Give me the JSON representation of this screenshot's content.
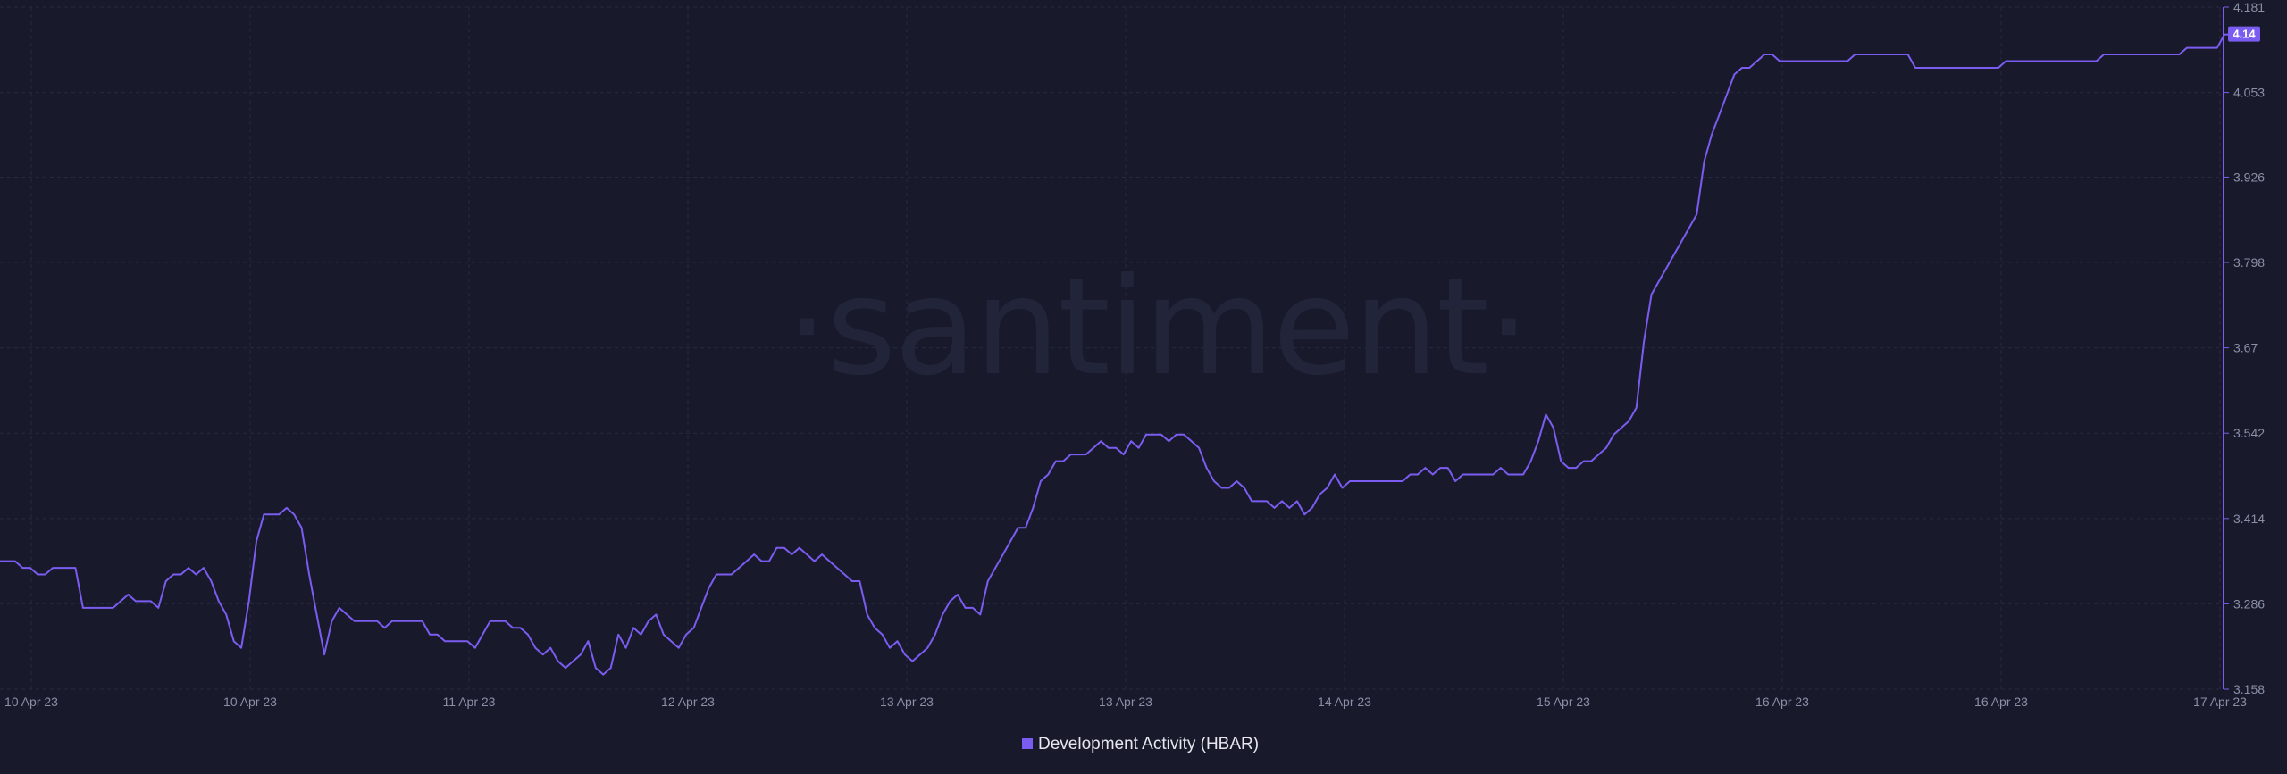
{
  "chart_data": {
    "type": "line",
    "title": "",
    "xlabel": "",
    "ylabel": "",
    "watermark": "·santiment·",
    "accent_color": "#7b5cf0",
    "background_color": "#181a2b",
    "grid": true,
    "legend_position": "bottom-center",
    "ylim": [
      3.158,
      4.181
    ],
    "y_ticks": [
      "4.181",
      "4.053",
      "3.926",
      "3.798",
      "3.67",
      "3.542",
      "3.414",
      "3.286",
      "3.158"
    ],
    "x_ticks": [
      "10 Apr 23",
      "10 Apr 23",
      "11 Apr 23",
      "12 Apr 23",
      "13 Apr 23",
      "13 Apr 23",
      "14 Apr 23",
      "15 Apr 23",
      "16 Apr 23",
      "16 Apr 23",
      "17 Apr 23"
    ],
    "last_value_label": "4.14",
    "series": [
      {
        "name": "Development Activity (HBAR)",
        "color": "#7b5cf0",
        "x_range": [
          "10 Apr 23",
          "17 Apr 23"
        ],
        "values": [
          3.35,
          3.35,
          3.35,
          3.34,
          3.34,
          3.33,
          3.33,
          3.34,
          3.34,
          3.34,
          3.34,
          3.28,
          3.28,
          3.28,
          3.28,
          3.28,
          3.29,
          3.3,
          3.29,
          3.29,
          3.29,
          3.28,
          3.32,
          3.33,
          3.33,
          3.34,
          3.33,
          3.34,
          3.32,
          3.29,
          3.27,
          3.23,
          3.22,
          3.29,
          3.38,
          3.42,
          3.42,
          3.42,
          3.43,
          3.42,
          3.4,
          3.33,
          3.27,
          3.21,
          3.26,
          3.28,
          3.27,
          3.26,
          3.26,
          3.26,
          3.26,
          3.25,
          3.26,
          3.26,
          3.26,
          3.26,
          3.26,
          3.24,
          3.24,
          3.23,
          3.23,
          3.23,
          3.23,
          3.22,
          3.24,
          3.26,
          3.26,
          3.26,
          3.25,
          3.25,
          3.24,
          3.22,
          3.21,
          3.22,
          3.2,
          3.19,
          3.2,
          3.21,
          3.23,
          3.19,
          3.18,
          3.19,
          3.24,
          3.22,
          3.25,
          3.24,
          3.26,
          3.27,
          3.24,
          3.23,
          3.22,
          3.24,
          3.25,
          3.28,
          3.31,
          3.33,
          3.33,
          3.33,
          3.34,
          3.35,
          3.36,
          3.35,
          3.35,
          3.37,
          3.37,
          3.36,
          3.37,
          3.36,
          3.35,
          3.36,
          3.35,
          3.34,
          3.33,
          3.32,
          3.32,
          3.27,
          3.25,
          3.24,
          3.22,
          3.23,
          3.21,
          3.2,
          3.21,
          3.22,
          3.24,
          3.27,
          3.29,
          3.3,
          3.28,
          3.28,
          3.27,
          3.32,
          3.34,
          3.36,
          3.38,
          3.4,
          3.4,
          3.43,
          3.47,
          3.48,
          3.5,
          3.5,
          3.51,
          3.51,
          3.51,
          3.52,
          3.53,
          3.52,
          3.52,
          3.51,
          3.53,
          3.52,
          3.54,
          3.54,
          3.54,
          3.53,
          3.54,
          3.54,
          3.53,
          3.52,
          3.49,
          3.47,
          3.46,
          3.46,
          3.47,
          3.46,
          3.44,
          3.44,
          3.44,
          3.43,
          3.44,
          3.43,
          3.44,
          3.42,
          3.43,
          3.45,
          3.46,
          3.48,
          3.46,
          3.47,
          3.47,
          3.47,
          3.47,
          3.47,
          3.47,
          3.47,
          3.47,
          3.48,
          3.48,
          3.49,
          3.48,
          3.49,
          3.49,
          3.47,
          3.48,
          3.48,
          3.48,
          3.48,
          3.48,
          3.49,
          3.48,
          3.48,
          3.48,
          3.5,
          3.53,
          3.57,
          3.55,
          3.5,
          3.49,
          3.49,
          3.5,
          3.5,
          3.51,
          3.52,
          3.54,
          3.55,
          3.56,
          3.58,
          3.68,
          3.75,
          3.77,
          3.79,
          3.81,
          3.83,
          3.85,
          3.87,
          3.95,
          3.99,
          4.02,
          4.05,
          4.08,
          4.09,
          4.09,
          4.1,
          4.11,
          4.11,
          4.1,
          4.1,
          4.1,
          4.1,
          4.1,
          4.1,
          4.1,
          4.1,
          4.1,
          4.1,
          4.11,
          4.11,
          4.11,
          4.11,
          4.11,
          4.11,
          4.11,
          4.11,
          4.09,
          4.09,
          4.09,
          4.09,
          4.09,
          4.09,
          4.09,
          4.09,
          4.09,
          4.09,
          4.09,
          4.09,
          4.1,
          4.1,
          4.1,
          4.1,
          4.1,
          4.1,
          4.1,
          4.1,
          4.1,
          4.1,
          4.1,
          4.1,
          4.1,
          4.11,
          4.11,
          4.11,
          4.11,
          4.11,
          4.11,
          4.11,
          4.11,
          4.11,
          4.11,
          4.11,
          4.12,
          4.12,
          4.12,
          4.12,
          4.12,
          4.14,
          4.14,
          4.14
        ]
      }
    ]
  }
}
